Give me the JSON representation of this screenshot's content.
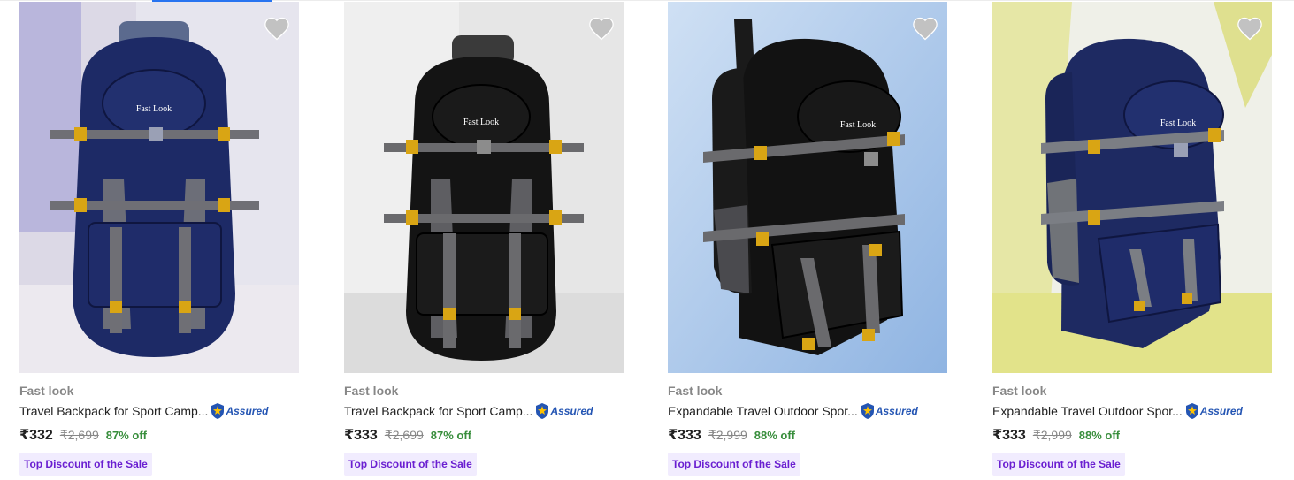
{
  "colors": {
    "assured_blue": "#2455b3",
    "discount_green": "#388e3c",
    "badge_purple": "#6a1fd1",
    "badge_bg": "#f1ecfe",
    "wishlist_grey": "#c2c2c2"
  },
  "products": [
    {
      "brand": "Fast look",
      "title": "Travel Backpack for Sport Camp...",
      "assured_label": "Assured",
      "price": "₹332",
      "mrp": "₹2,699",
      "discount": "87% off",
      "badge": "Top Discount of the Sale",
      "image_icon": "backpack-navy-grey-image",
      "image_logo": "Fast Look"
    },
    {
      "brand": "Fast look",
      "title": "Travel Backpack for Sport Camp...",
      "assured_label": "Assured",
      "price": "₹333",
      "mrp": "₹2,699",
      "discount": "87% off",
      "badge": "Top Discount of the Sale",
      "image_icon": "backpack-black-grey-image",
      "image_logo": "Fast Look"
    },
    {
      "brand": "Fast look",
      "title": "Expandable Travel Outdoor Spor...",
      "assured_label": "Assured",
      "price": "₹333",
      "mrp": "₹2,999",
      "discount": "88% off",
      "badge": "Top Discount of the Sale",
      "image_icon": "backpack-black-grey-image",
      "image_logo": "Fast Look"
    },
    {
      "brand": "Fast look",
      "title": "Expandable Travel Outdoor Spor...",
      "assured_label": "Assured",
      "price": "₹333",
      "mrp": "₹2,999",
      "discount": "88% off",
      "badge": "Top Discount of the Sale",
      "image_icon": "backpack-navy-grey-image",
      "image_logo": "Fast Look"
    }
  ]
}
